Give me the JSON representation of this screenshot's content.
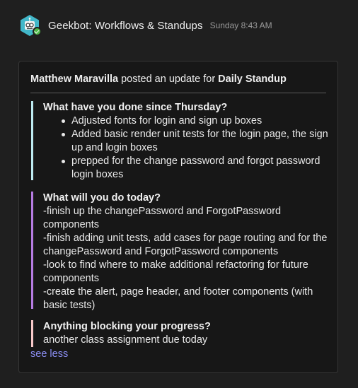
{
  "message": {
    "sender": "Geekbot: Workflows & Standups",
    "timestamp": "Sunday 8:43 AM",
    "avatar_icon": "geekbot-robot-icon",
    "status": "online",
    "colors": {
      "avatar_bg": "#42b7c9",
      "online": "#4fb848"
    }
  },
  "card": {
    "author": "Matthew Maravilla",
    "posted_text": " posted an update for ",
    "standup": "Daily Standup",
    "sections": [
      {
        "question": "What have you done since Thursday?",
        "accent": "#bdeaf0",
        "items": [
          "Adjusted fonts for login and sign up boxes",
          "Added basic render unit tests for the login page, the sign up and login boxes",
          "prepped for the change password and forgot password login boxes"
        ]
      },
      {
        "question": "What will you do today?",
        "accent": "#b57be1",
        "lines": [
          "-finish up the changePassword and ForgotPassword components",
          "-finish adding unit tests, add cases for page routing and for the changePassword and ForgotPassword components",
          "-look to find where to make additional refactoring for future components",
          "-create the alert, page header, and footer components (with basic tests)"
        ]
      },
      {
        "question": "Anything blocking your progress?",
        "accent": "#f7c8c8",
        "answer": "another class assignment due today"
      }
    ],
    "toggle_label": "see less",
    "link_color": "#8c8ff4"
  }
}
